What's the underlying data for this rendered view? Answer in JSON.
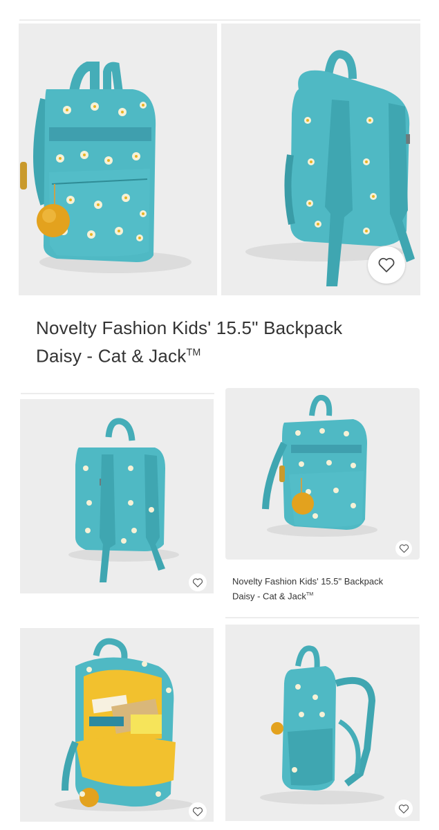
{
  "product": {
    "title_line1": "Novelty Fashion Kids' 15.5\" Backpack",
    "title_line2": "Daisy - Cat & Jack",
    "trademark": "TM"
  },
  "listing": {
    "title_line1": "Novelty Fashion Kids' 15.5\" Backpack",
    "title_line2": "Daisy - Cat & Jack",
    "trademark": "TM"
  },
  "icons": {
    "favorite": "heart-outline-icon"
  },
  "colors": {
    "bag": "#4fb9c4",
    "bag_dark": "#3aa0ab",
    "daisy_petal": "#f6f1d6",
    "daisy_center": "#e8b423",
    "pompom": "#e3a21e",
    "lining": "#f2c12e",
    "card_bg": "#ededed"
  }
}
